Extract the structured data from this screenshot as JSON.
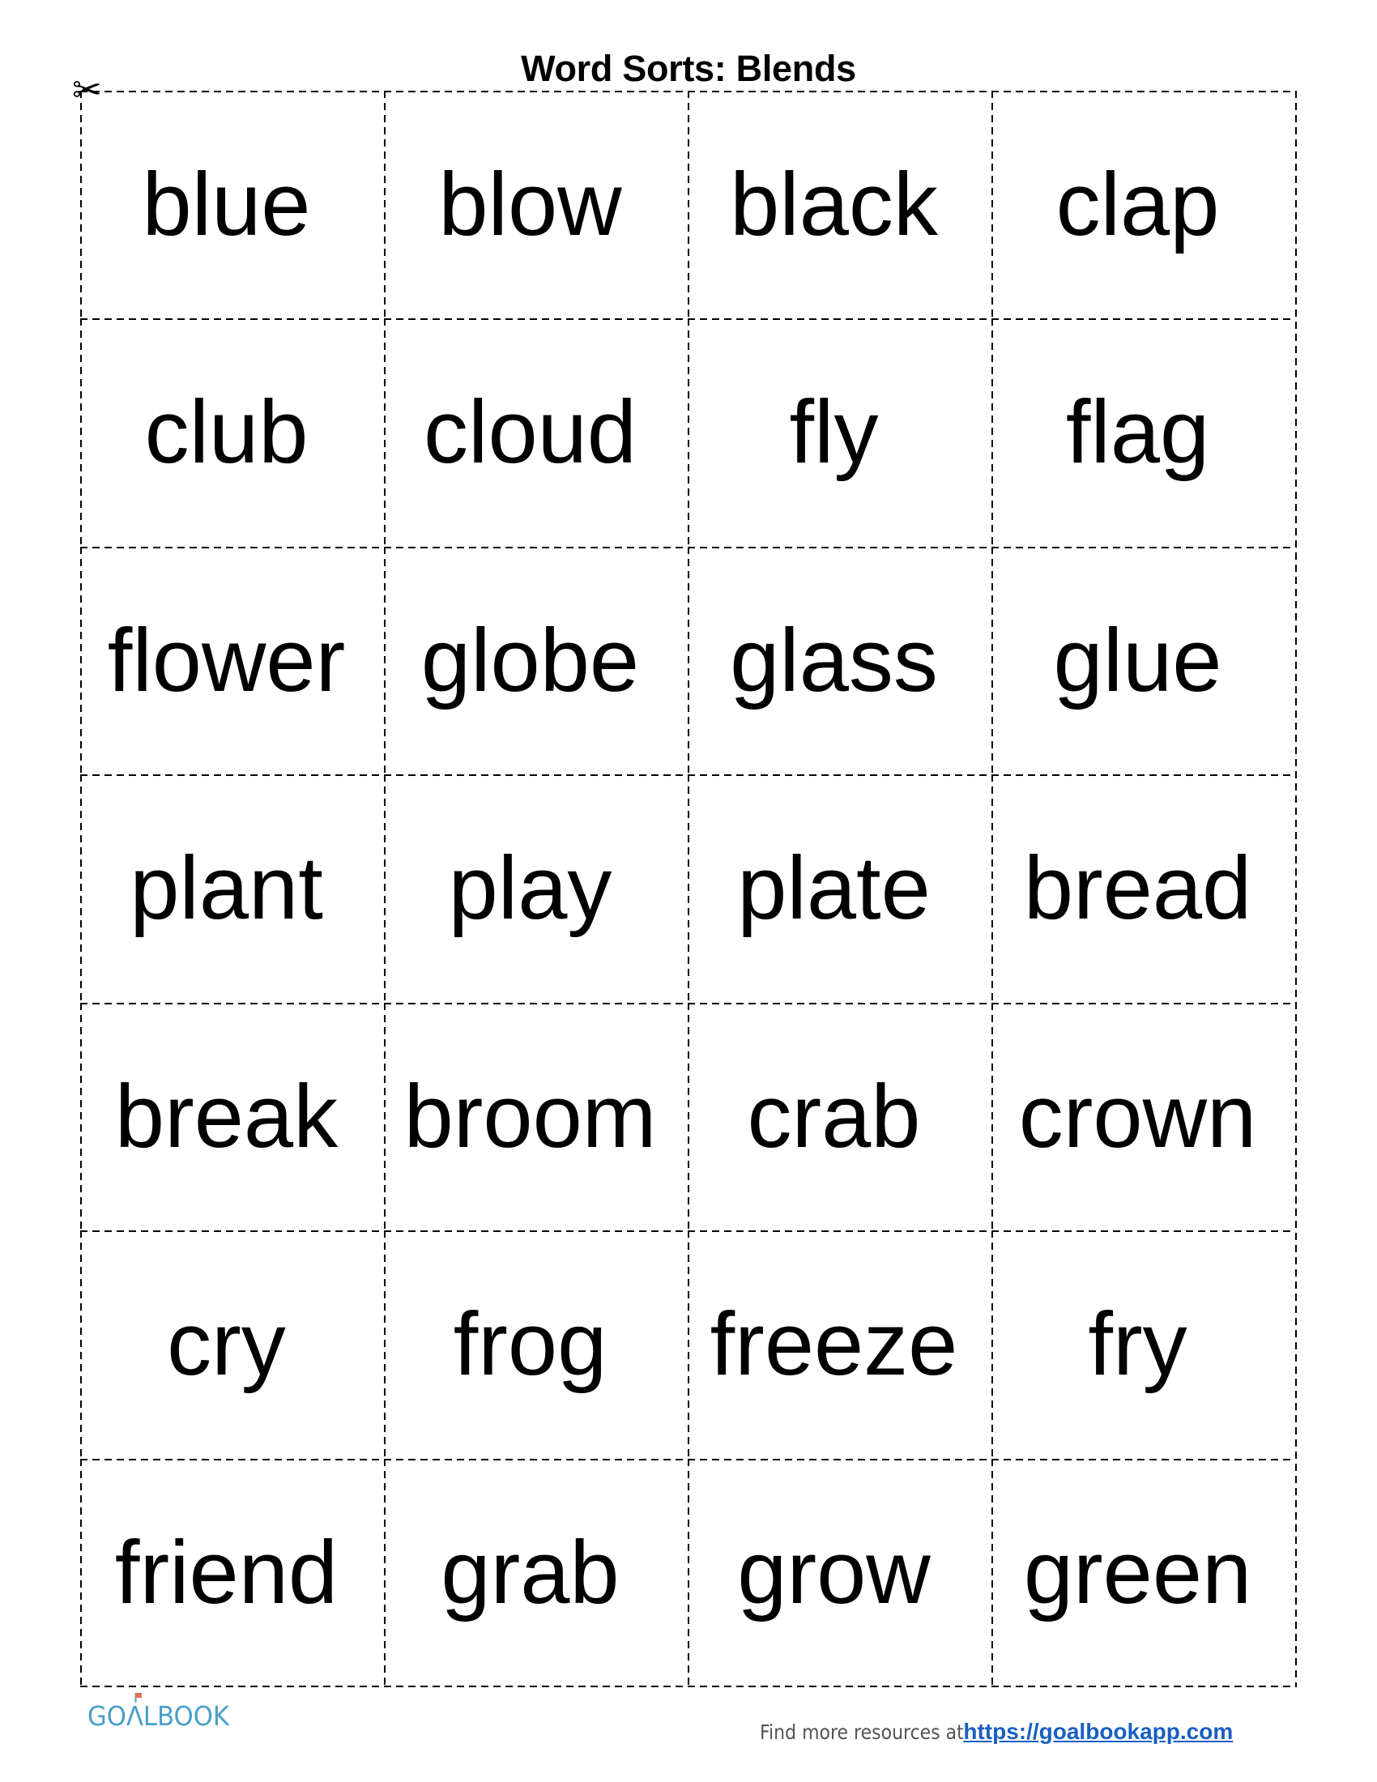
{
  "title": "Word Sorts: Blends",
  "cut_icon": "scissors-icon",
  "words": [
    [
      "blue",
      "blow",
      "black",
      "clap"
    ],
    [
      "club",
      "cloud",
      "fly",
      "flag"
    ],
    [
      "flower",
      "globe",
      "glass",
      "glue"
    ],
    [
      "plant",
      "play",
      "plate",
      "bread"
    ],
    [
      "break",
      "broom",
      "crab",
      "crown"
    ],
    [
      "cry",
      "frog",
      "freeze",
      "fry"
    ],
    [
      "friend",
      "grab",
      "grow",
      "green"
    ]
  ],
  "footer": {
    "logo_text": "GOALBOOK",
    "logo_color": "#4a9fc9",
    "lead_text": "Find more resources at",
    "link_text": "https://goalbookapp.com",
    "link_color": "#1a5fc1"
  }
}
